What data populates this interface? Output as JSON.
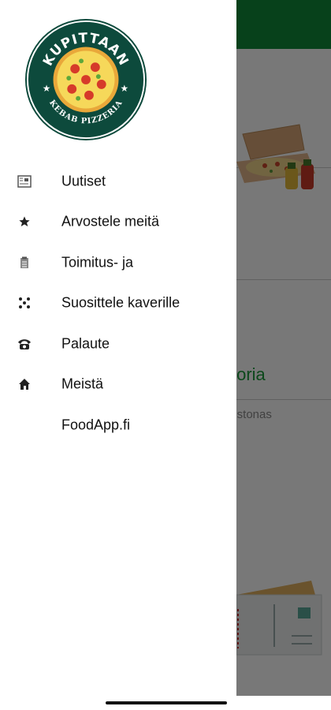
{
  "background": {
    "section_title": "toria",
    "section_subtitle": "listonas",
    "colors": {
      "topbar": "#0f8a3a",
      "accent_text": "#1a9a3a"
    }
  },
  "logo": {
    "top_text": "KUPITTAAN",
    "bottom_text": "KEBAB PIZZERIA"
  },
  "menu": {
    "items": [
      {
        "label": "Uutiset",
        "icon": "newspaper-icon"
      },
      {
        "label": "Arvostele meitä",
        "icon": "star-icon"
      },
      {
        "label": "Toimitus- ja",
        "icon": "document-icon"
      },
      {
        "label": "Suosittele kaverille",
        "icon": "share-icon"
      },
      {
        "label": "Palaute",
        "icon": "phone-icon"
      },
      {
        "label": "Meistä",
        "icon": "home-icon"
      },
      {
        "label": "FoodApp.fi",
        "icon": ""
      }
    ]
  }
}
